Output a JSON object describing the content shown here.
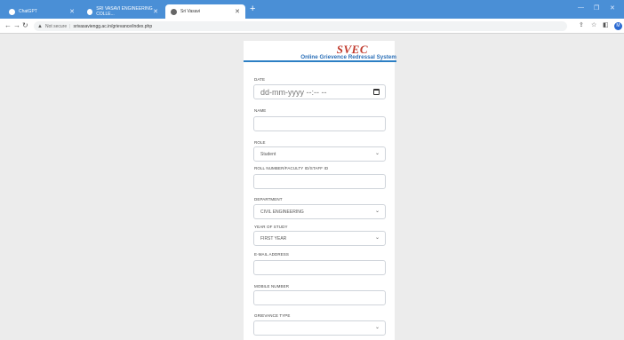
{
  "browser": {
    "tabs": [
      {
        "label": "ChatGPT",
        "active": false
      },
      {
        "label": "SRI VASAVI ENGINEERING COLLE...",
        "active": false
      },
      {
        "label": "Sri Vasavi",
        "active": true
      }
    ],
    "new_tab_icon": "plus-icon",
    "window_controls": [
      "minimize-icon",
      "restore-icon",
      "close-icon"
    ],
    "address": {
      "security_label": "Not secure",
      "url": "srivasaviengg.ac.in/grievance/index.php"
    }
  },
  "header": {
    "brand": "SVEC",
    "subtitle": "Online Grievence Redressal System"
  },
  "form": {
    "date": {
      "label": "DATE",
      "value": "dd-mm-yyyy --:-- --"
    },
    "name": {
      "label": "NAME",
      "value": ""
    },
    "role": {
      "label": "ROLE",
      "value": "Student"
    },
    "roll": {
      "label": "ROLL NUMBER/FACULTY ID/STAFF ID",
      "value": ""
    },
    "department": {
      "label": "DEPARTMENT",
      "value": "CIVIL ENGINEERING"
    },
    "year": {
      "label": "YEAR OF STUDY",
      "value": "FIRST YEAR"
    },
    "email": {
      "label": "E-MAIL ADDRESS",
      "value": ""
    },
    "mobile": {
      "label": "MOBILE NUMBER",
      "value": ""
    },
    "grievance_type": {
      "label": "GRIEVANCE TYPE",
      "value": ""
    }
  }
}
